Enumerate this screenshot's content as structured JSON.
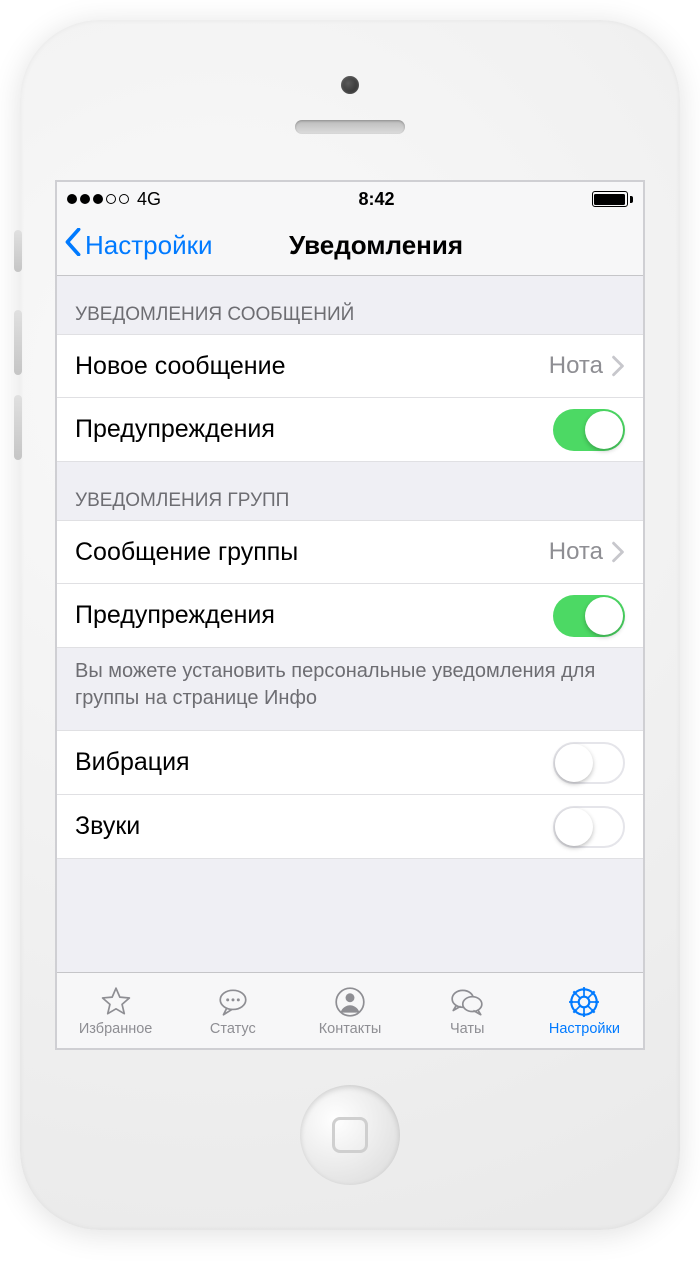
{
  "statusbar": {
    "signal_filled": 3,
    "signal_total": 5,
    "carrier": "4G",
    "time": "8:42"
  },
  "nav": {
    "back_label": "Настройки",
    "title": "Уведомления"
  },
  "sections": {
    "messages": {
      "header": "УВЕДОМЛЕНИЯ СООБЩЕНИЙ",
      "new_message_label": "Новое сообщение",
      "new_message_value": "Нота",
      "alerts_label": "Предупреждения",
      "alerts_on": true
    },
    "groups": {
      "header": "УВЕДОМЛЕНИЯ ГРУПП",
      "group_message_label": "Сообщение группы",
      "group_message_value": "Нота",
      "alerts_label": "Предупреждения",
      "alerts_on": true,
      "footer_note": "Вы можете установить персональные уведомления для группы на странице Инфо"
    },
    "misc": {
      "vibration_label": "Вибрация",
      "vibration_on": false,
      "sounds_label": "Звуки",
      "sounds_on": false
    }
  },
  "tabs": {
    "favorites": "Избранное",
    "status": "Статус",
    "contacts": "Контакты",
    "chats": "Чаты",
    "settings": "Настройки"
  },
  "colors": {
    "tint": "#007aff",
    "switch_on": "#4cd964",
    "grey_value": "#8e8e93",
    "bg": "#efeff4"
  }
}
